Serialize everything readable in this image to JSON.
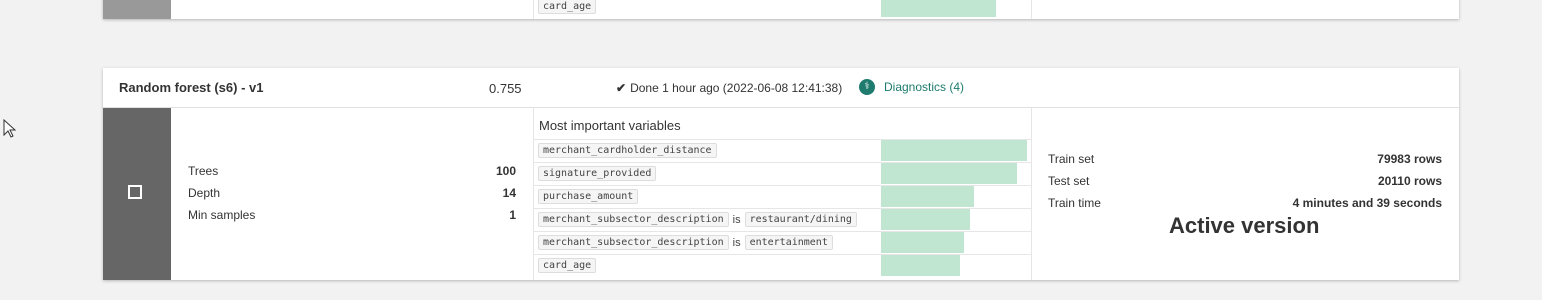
{
  "prev_card": {
    "last_variable_tag": "card_age",
    "last_bar_fraction": 0.79
  },
  "model": {
    "title": "Random forest (s6) - v1",
    "score": "0.755",
    "status_icon": "check-icon",
    "status": "Done 1 hour ago (2022-06-08 12:41:38)",
    "diagnostics_label": "Diagnostics (4)",
    "diagnostics_color": "#1e7b6e"
  },
  "params": [
    {
      "label": "Trees",
      "value": "100"
    },
    {
      "label": "Depth",
      "value": "14"
    },
    {
      "label": "Min samples",
      "value": "1"
    }
  ],
  "variables": {
    "title": "Most important variables",
    "bar_color": "#c0e6d2",
    "rows": [
      {
        "name": "merchant_cardholder_distance",
        "is": "",
        "value": "",
        "importance": 1.0
      },
      {
        "name": "signature_provided",
        "is": "",
        "value": "",
        "importance": 0.93
      },
      {
        "name": "purchase_amount",
        "is": "",
        "value": "",
        "importance": 0.64
      },
      {
        "name": "merchant_subsector_description",
        "is": "is",
        "value": "restaurant/dining",
        "importance": 0.61
      },
      {
        "name": "merchant_subsector_description",
        "is": "is",
        "value": "entertainment",
        "importance": 0.57
      },
      {
        "name": "card_age",
        "is": "",
        "value": "",
        "importance": 0.54
      }
    ]
  },
  "stats": [
    {
      "label": "Train set",
      "value": "79983 rows"
    },
    {
      "label": "Test set",
      "value": "20110 rows"
    },
    {
      "label": "Train time",
      "value": "4 minutes and 39 seconds"
    }
  ],
  "active_label": "Active version"
}
